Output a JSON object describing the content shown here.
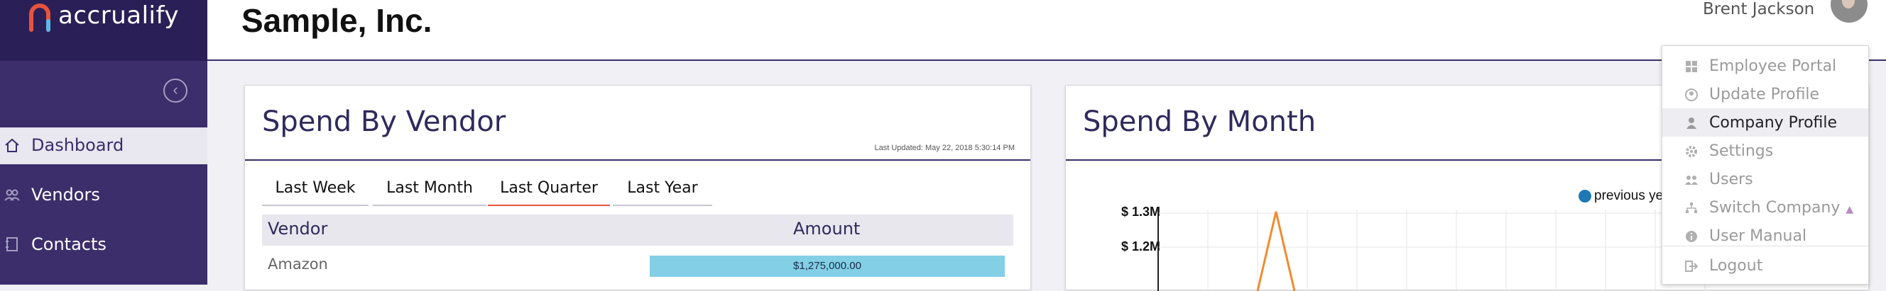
{
  "brand": {
    "name": "accrualify",
    "accent": "#e8543b",
    "primary": "#3b2e6b"
  },
  "header": {
    "company": "Sample, Inc.",
    "user_name": "Brent Jackson"
  },
  "sidebar": {
    "collapse_icon": "chevron-left-icon",
    "items": [
      {
        "label": "Dashboard",
        "icon": "home-icon",
        "active": true
      },
      {
        "label": "Vendors",
        "icon": "users-icon",
        "active": false
      },
      {
        "label": "Contacts",
        "icon": "address-book-icon",
        "active": false
      }
    ]
  },
  "vendor_card": {
    "title": "Spend By Vendor",
    "last_updated": "Last Updated: May 22, 2018 5:30:14 PM",
    "tabs": [
      {
        "label": "Last Week",
        "active": false
      },
      {
        "label": "Last Month",
        "active": false
      },
      {
        "label": "Last Quarter",
        "active": true
      },
      {
        "label": "Last Year",
        "active": false
      }
    ],
    "columns": {
      "vendor": "Vendor",
      "amount": "Amount"
    },
    "rows": [
      {
        "vendor": "Amazon",
        "amount": "$1,275,000.00",
        "bar_fraction": 1.0
      }
    ]
  },
  "month_card": {
    "title": "Spend By Month",
    "legend": "previous ye",
    "legend_color": "#1f78b4",
    "y_ticks": [
      "$ 1.3M",
      "$ 1.2M"
    ],
    "line_color": "#f28a2e"
  },
  "user_menu": {
    "items": [
      {
        "label": "Employee Portal",
        "icon": "grid-icon",
        "active": false
      },
      {
        "label": "Update Profile",
        "icon": "user-circle-icon",
        "active": false
      },
      {
        "label": "Company Profile",
        "icon": "user-icon",
        "active": true
      },
      {
        "label": "Settings",
        "icon": "gear-icon",
        "active": false
      },
      {
        "label": "Users",
        "icon": "users-icon",
        "active": false
      },
      {
        "label": "Switch Company",
        "icon": "sitemap-icon",
        "active": false
      },
      {
        "label": "User Manual",
        "icon": "info-icon",
        "active": false
      },
      {
        "label": "Logout",
        "icon": "logout-icon",
        "active": false
      }
    ]
  }
}
